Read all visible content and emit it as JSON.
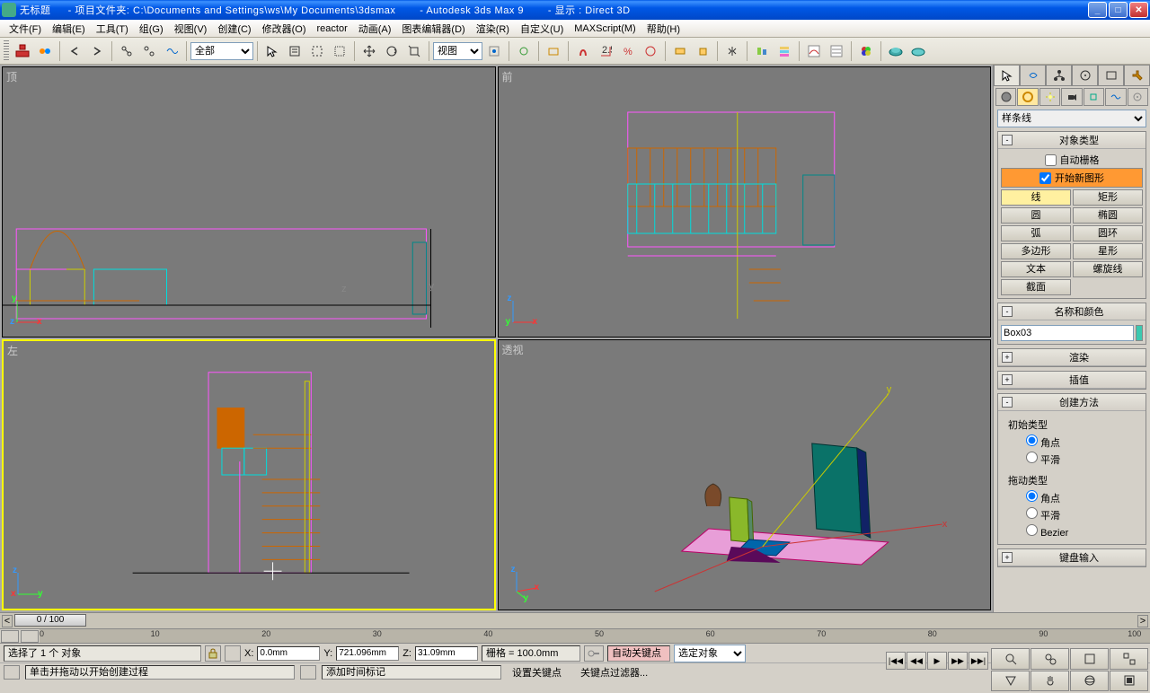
{
  "titlebar": {
    "doc_name": "无标题",
    "project_label": "- 项目文件夹: C:\\Documents and Settings\\ws\\My Documents\\3dsmax",
    "app_name": "- Autodesk 3ds Max 9",
    "display_label": "- 显示 : Direct 3D"
  },
  "menu": {
    "items": [
      "文件(F)",
      "编辑(E)",
      "工具(T)",
      "组(G)",
      "视图(V)",
      "创建(C)",
      "修改器(O)",
      "reactor",
      "动画(A)",
      "图表编辑器(D)",
      "渲染(R)",
      "自定义(U)",
      "MAXScript(M)",
      "帮助(H)"
    ]
  },
  "toolbar": {
    "selection_filter": "全部",
    "ref_coord": "视图"
  },
  "viewports": {
    "top": "顶",
    "front": "前",
    "left": "左",
    "perspective": "透视"
  },
  "command_panel": {
    "category": "样条线",
    "rollout_object_type": "对象类型",
    "autogrid_label": "自动栅格",
    "start_new_shape_label": "开始新图形",
    "shape_buttons": [
      [
        "线",
        "矩形"
      ],
      [
        "圆",
        "椭圆"
      ],
      [
        "弧",
        "圆环"
      ],
      [
        "多边形",
        "星形"
      ],
      [
        "文本",
        "螺旋线"
      ],
      [
        "截面",
        ""
      ]
    ],
    "rollout_name_color": "名称和颜色",
    "object_name": "Box03",
    "object_color": "#3cc9b0",
    "rollout_render": "渲染",
    "rollout_interp": "插值",
    "rollout_creation": "创建方法",
    "initial_type_label": "初始类型",
    "drag_type_label": "拖动类型",
    "radio_corner": "角点",
    "radio_smooth": "平滑",
    "radio_bezier": "Bezier",
    "rollout_keyboard": "键盘输入"
  },
  "timeline": {
    "frame_indicator": "0 / 100",
    "ticks": [
      0,
      10,
      20,
      30,
      40,
      50,
      60,
      70,
      80,
      90,
      100
    ]
  },
  "status": {
    "selection_info": "选择了 1 个 对象",
    "x_label": "X:",
    "x_value": "0.0mm",
    "y_label": "Y:",
    "y_value": "721.096mm",
    "z_label": "Z:",
    "z_value": "31.09mm",
    "grid_label": "栅格 = 100.0mm",
    "auto_key": "自动关键点",
    "selected_obj": "选定对象",
    "prompt": "单击并拖动以开始创建过程",
    "add_time_tag": "添加时间标记",
    "set_key": "设置关键点",
    "key_filter": "关键点过滤器..."
  }
}
